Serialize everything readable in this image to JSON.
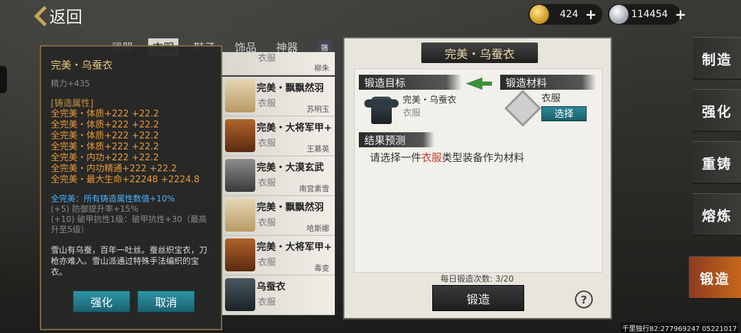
{
  "header": {
    "back_label": "返回",
    "gold": "424",
    "silver": "114454"
  },
  "side_menu": {
    "items": [
      "制造",
      "强化",
      "重铸",
      "熔炼",
      "锻造"
    ],
    "active": "锻造"
  },
  "tabs": {
    "items": [
      "武器",
      "衣服",
      "鞋子",
      "饰品",
      "神器"
    ],
    "active": "衣服",
    "filter_label": "筛"
  },
  "list": [
    {
      "name": "",
      "type": "衣服",
      "owner": "柳朱"
    },
    {
      "name": "完美・飘飘然羽",
      "type": "衣服",
      "owner": "苏明玉"
    },
    {
      "name": "完美・大将军甲+",
      "type": "衣服",
      "owner": "王慕英"
    },
    {
      "name": "完美・大漠玄武",
      "type": "衣服",
      "owner": "南宫素雪"
    },
    {
      "name": "完美・飘飘然羽",
      "type": "衣服",
      "owner": "哈斯娜"
    },
    {
      "name": "完美・大将军甲+",
      "type": "衣服",
      "owner": "毒变"
    },
    {
      "name": "乌蚕衣",
      "type": "衣服",
      "owner": ""
    }
  ],
  "tooltip": {
    "title": "完美・乌蚕衣",
    "subtitle": "精力+435",
    "section_header": "[铸造属性]",
    "attributes": [
      "全完美・体质+222  +22.2",
      "全完美・体质+222  +22.2",
      "全完美・体质+222  +22.2",
      "全完美・体质+222  +22.2",
      "全完美・内功+222  +22.2",
      "全完美・内功精通+222  +22.2",
      "全完美・最大生命+22248  +2224.8"
    ],
    "blue_line": "全完美：所有铸造属性数值+10%",
    "gray_lines": [
      "(+5) 防御提升率+15%",
      "(+10) 破甲抗性1级：破甲抗性+30（最高升至5级）"
    ],
    "description": "雪山有乌蚕，百年一吐丝。蚕丝织宝衣，刀枪亦难入。雪山派通过特殊手法编织的宝衣。",
    "enhance_label": "强化",
    "cancel_label": "取消"
  },
  "panel": {
    "title": "完美・乌蚕衣",
    "target_label": "锻造目标",
    "material_label": "锻造材料",
    "target_item_name": "完美・乌蚕衣",
    "target_item_type": "衣服",
    "material_name": "衣服",
    "select_label": "选择",
    "result_label": "结果预测",
    "result_prefix": "请选择一件",
    "result_highlight": "衣服",
    "result_suffix": "类型装备作为材料",
    "daily_count": "每日锻造次数: 3/20",
    "forge_label": "锻造",
    "help_label": "?"
  },
  "watermark": "千里独行82:277969247  05221017"
}
